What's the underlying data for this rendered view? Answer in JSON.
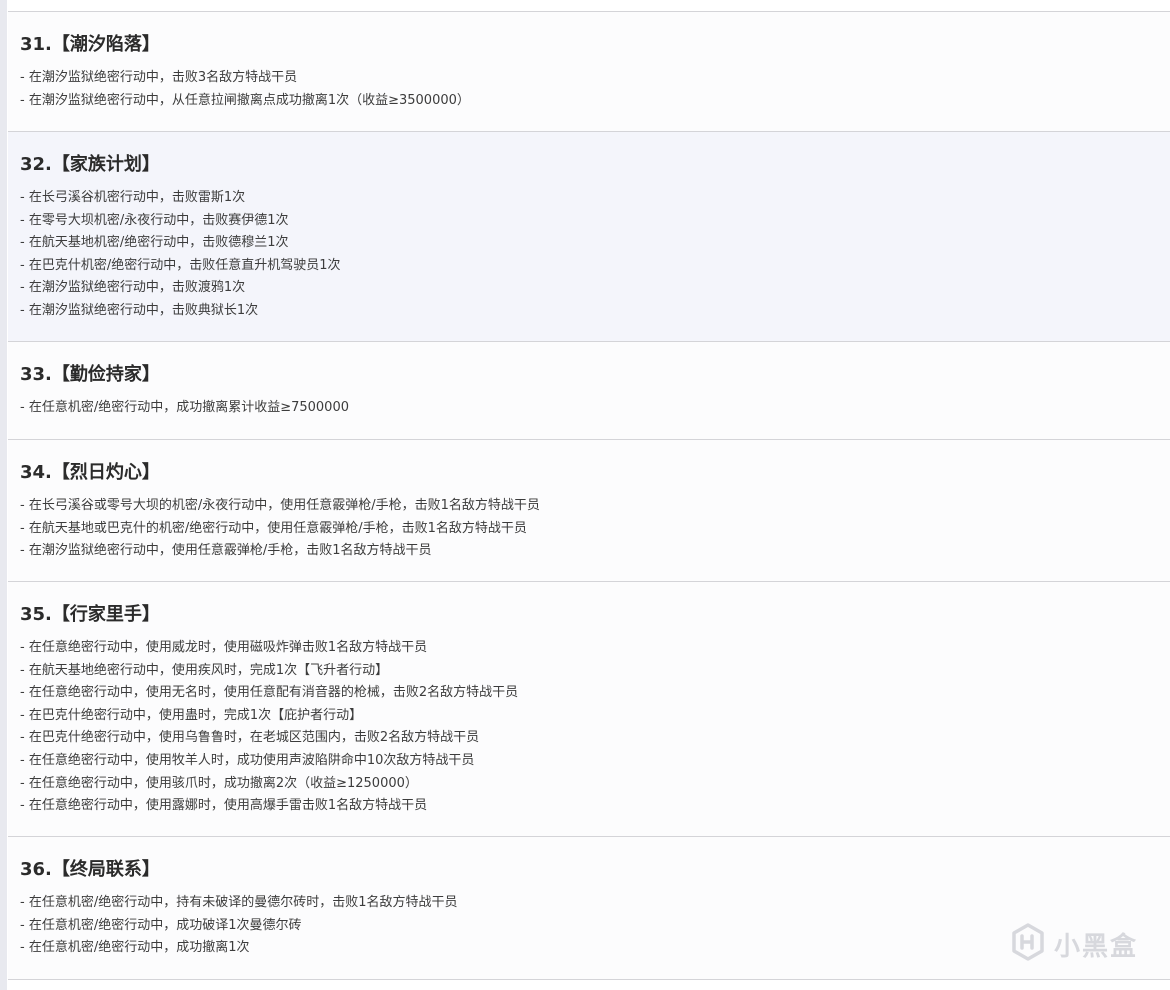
{
  "sections": [
    {
      "title": "31.【潮汐陷落】",
      "items": [
        "- 在潮汐监狱绝密行动中，击败3名敌方特战干员",
        "- 在潮汐监狱绝密行动中，从任意拉闸撤离点成功撤离1次（收益≥3500000）"
      ]
    },
    {
      "title": "32.【家族计划】",
      "items": [
        "- 在长弓溪谷机密行动中，击败雷斯1次",
        "- 在零号大坝机密/永夜行动中，击败赛伊德1次",
        "- 在航天基地机密/绝密行动中，击败德穆兰1次",
        "- 在巴克什机密/绝密行动中，击败任意直升机驾驶员1次",
        "- 在潮汐监狱绝密行动中，击败渡鸦1次",
        "- 在潮汐监狱绝密行动中，击败典狱长1次"
      ]
    },
    {
      "title": "33.【勤俭持家】",
      "items": [
        "- 在任意机密/绝密行动中，成功撤离累计收益≥7500000"
      ]
    },
    {
      "title": "34.【烈日灼心】",
      "items": [
        "- 在长弓溪谷或零号大坝的机密/永夜行动中，使用任意霰弹枪/手枪，击败1名敌方特战干员",
        "- 在航天基地或巴克什的机密/绝密行动中，使用任意霰弹枪/手枪，击败1名敌方特战干员",
        "- 在潮汐监狱绝密行动中，使用任意霰弹枪/手枪，击败1名敌方特战干员"
      ]
    },
    {
      "title": "35.【行家里手】",
      "items": [
        "- 在任意绝密行动中，使用威龙时，使用磁吸炸弹击败1名敌方特战干员",
        "- 在航天基地绝密行动中，使用疾风时，完成1次【飞升者行动】",
        "- 在任意绝密行动中，使用无名时，使用任意配有消音器的枪械，击败2名敌方特战干员",
        "- 在巴克什绝密行动中，使用蛊时，完成1次【庇护者行动】",
        "- 在巴克什绝密行动中，使用乌鲁鲁时，在老城区范围内，击败2名敌方特战干员",
        "- 在任意绝密行动中，使用牧羊人时，成功使用声波陷阱命中10次敌方特战干员",
        "- 在任意绝密行动中，使用骇爪时，成功撤离2次（收益≥1250000）",
        "- 在任意绝密行动中，使用露娜时，使用高爆手雷击败1名敌方特战干员"
      ]
    },
    {
      "title": "36.【终局联系】",
      "items": [
        "- 在任意机密/绝密行动中，持有未破译的曼德尔砖时，击败1名敌方特战干员",
        "- 在任意机密/绝密行动中，成功破译1次曼德尔砖",
        "- 在任意机密/绝密行动中，成功撤离1次"
      ]
    }
  ],
  "watermark": {
    "text": "小黑盒",
    "icon": "xiaoheihe-logo-icon"
  }
}
